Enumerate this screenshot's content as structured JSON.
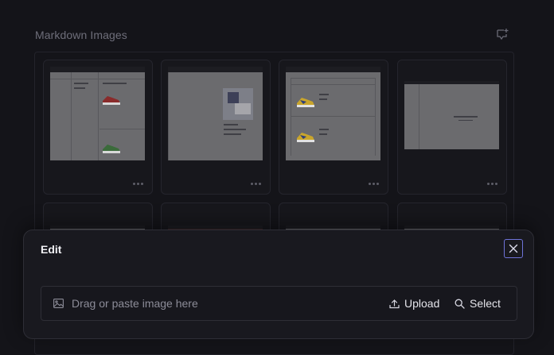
{
  "section": {
    "title": "Markdown Images",
    "add_comment_icon": "comment-plus-icon"
  },
  "gallery": {
    "items": [
      {
        "alt": "screenshot-1"
      },
      {
        "alt": "screenshot-2"
      },
      {
        "alt": "screenshot-3"
      },
      {
        "alt": "screenshot-4"
      },
      {
        "alt": "screenshot-5"
      },
      {
        "alt": "screenshot-6"
      },
      {
        "alt": "screenshot-7"
      },
      {
        "alt": "screenshot-8"
      }
    ],
    "more_icon": "ellipsis-icon"
  },
  "modal": {
    "title": "Edit",
    "close_icon": "close-icon",
    "dropzone": {
      "placeholder": "Drag or paste image here",
      "upload_label": "Upload",
      "select_label": "Select"
    }
  },
  "colors": {
    "accent": "#6f73d9",
    "background": "#141419",
    "panel": "#19191f"
  }
}
